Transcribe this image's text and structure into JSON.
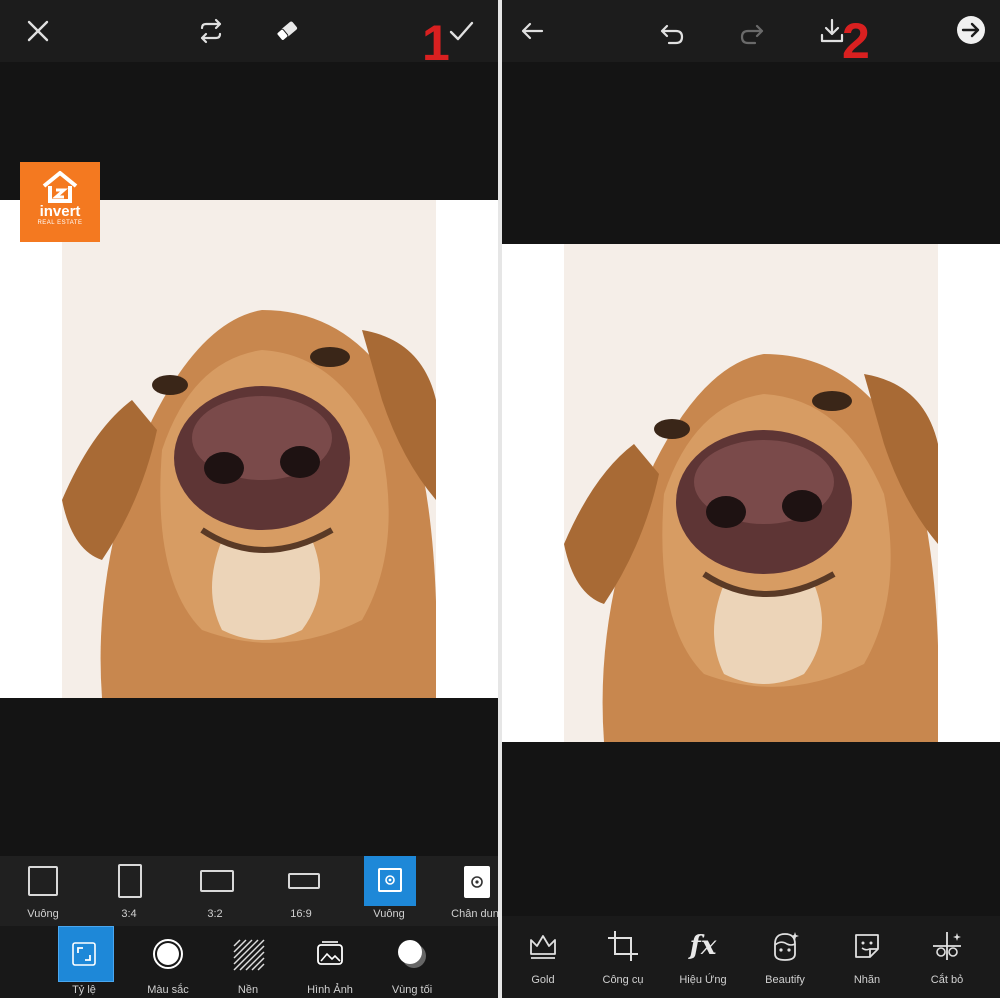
{
  "left_panel": {
    "step_badge": "1",
    "ratio_options": [
      {
        "label": "Vuông",
        "selected": false
      },
      {
        "label": "3:4",
        "selected": false
      },
      {
        "label": "3:2",
        "selected": false
      },
      {
        "label": "16:9",
        "selected": false
      },
      {
        "label": "Vuông",
        "selected": true
      },
      {
        "label": "Chân dun",
        "selected": false
      }
    ],
    "tools": [
      {
        "label": "Tỷ lệ",
        "icon": "aspect-ratio-icon",
        "selected": true
      },
      {
        "label": "Màu sắc",
        "icon": "color-circle-icon",
        "selected": false
      },
      {
        "label": "Nền",
        "icon": "pattern-background-icon",
        "selected": false
      },
      {
        "label": "Hình Ảnh",
        "icon": "image-icon",
        "selected": false
      },
      {
        "label": "Vùng tối",
        "icon": "shadow-icon",
        "selected": false
      }
    ]
  },
  "right_panel": {
    "step_badge": "2",
    "tools": [
      {
        "label": "Gold",
        "icon": "crown-icon"
      },
      {
        "label": "Công cụ",
        "icon": "crop-icon"
      },
      {
        "label": "Hiệu Ứng",
        "icon": "fx-icon",
        "glyph": "fx"
      },
      {
        "label": "Beautify",
        "icon": "beautify-face-icon"
      },
      {
        "label": "Nhãn",
        "icon": "sticker-icon"
      },
      {
        "label": "Cắt bỏ",
        "icon": "cutout-icon"
      }
    ]
  },
  "watermark": {
    "name": "invert",
    "tagline": "REAL ESTATE"
  },
  "colors": {
    "accent": "#1e88d8",
    "badge": "#d92020",
    "logo": "#f47920",
    "dark_bg": "#141414"
  }
}
